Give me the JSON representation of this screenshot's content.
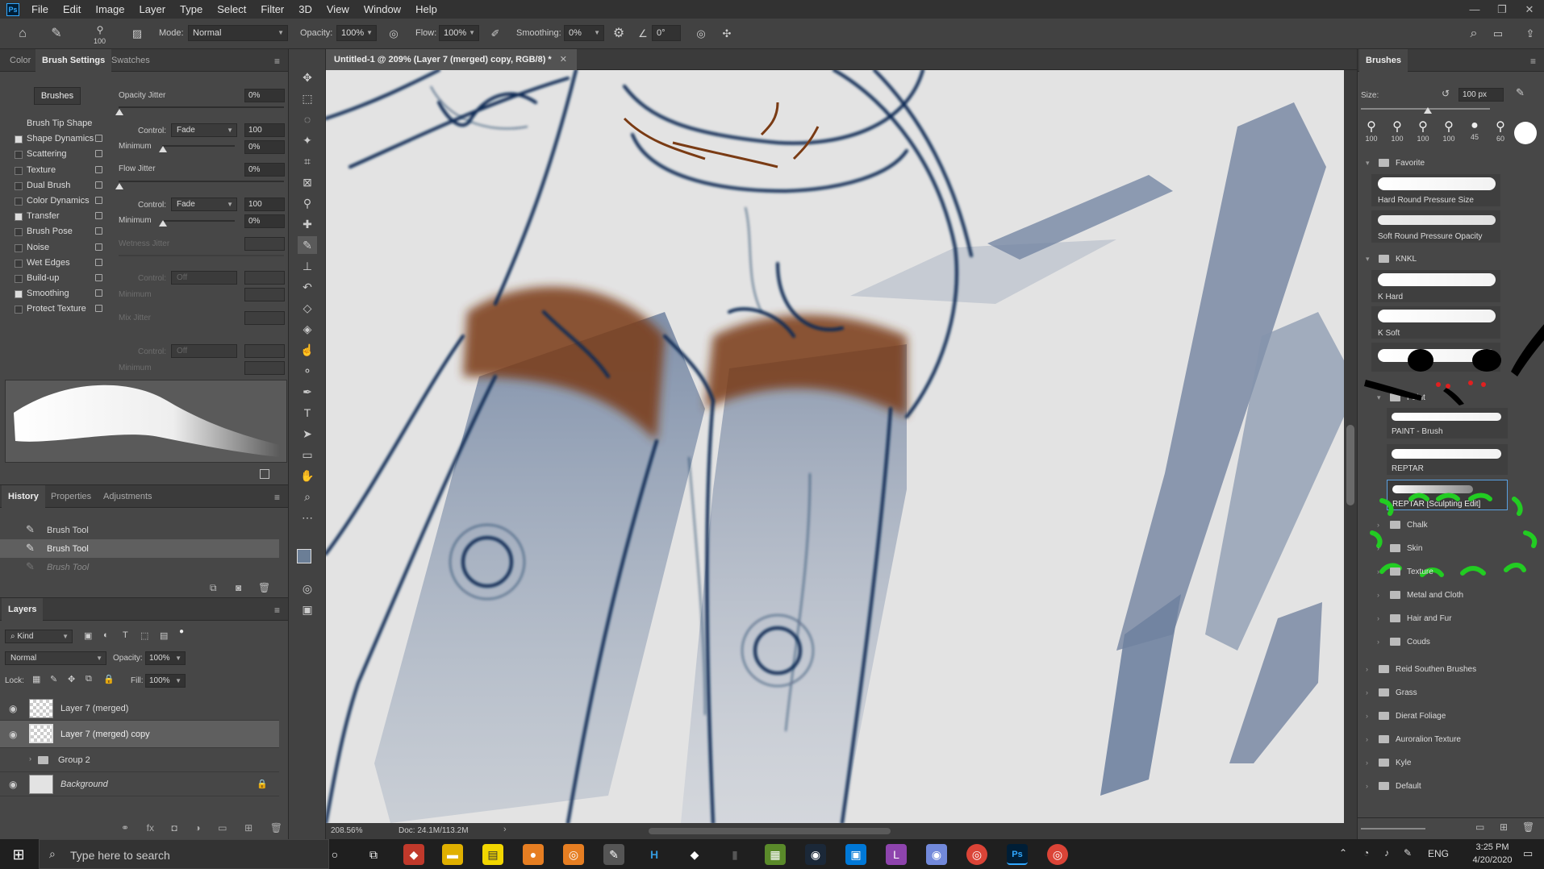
{
  "menu": {
    "items": [
      "File",
      "Edit",
      "Image",
      "Layer",
      "Type",
      "Select",
      "Filter",
      "3D",
      "View",
      "Window",
      "Help"
    ]
  },
  "options": {
    "brush_size": "100",
    "mode_label": "Mode:",
    "mode_value": "Normal",
    "opacity_label": "Opacity:",
    "opacity_value": "100%",
    "flow_label": "Flow:",
    "flow_value": "100%",
    "smoothing_label": "Smoothing:",
    "smoothing_value": "0%",
    "angle_value": "0°"
  },
  "left_panel": {
    "tabs": [
      "Color",
      "Brush Settings",
      "Swatches"
    ],
    "brushes_button": "Brushes",
    "items": [
      {
        "label": "Brush Tip Shape"
      },
      {
        "label": "Shape Dynamics",
        "checked": true
      },
      {
        "label": "Scattering",
        "checked": false
      },
      {
        "label": "Texture",
        "checked": false
      },
      {
        "label": "Dual Brush",
        "checked": false
      },
      {
        "label": "Color Dynamics",
        "checked": false
      },
      {
        "label": "Transfer",
        "checked": true
      },
      {
        "label": "Brush Pose",
        "checked": false
      },
      {
        "label": "Noise",
        "checked": false
      },
      {
        "label": "Wet Edges",
        "checked": false
      },
      {
        "label": "Build-up",
        "checked": false
      },
      {
        "label": "Smoothing",
        "checked": true
      },
      {
        "label": "Protect Texture",
        "checked": false
      }
    ],
    "transfer": {
      "opacity_jitter_label": "Opacity Jitter",
      "opacity_jitter": "0%",
      "control_label": "Control:",
      "control_value": "Fade",
      "control_num": "100",
      "minimum_label": "Minimum",
      "minimum": "0%",
      "flow_jitter_label": "Flow Jitter",
      "flow_jitter": "0%",
      "control2_value": "Fade",
      "control2_num": "100",
      "minimum2": "0%",
      "wetness_label": "Wetness Jitter",
      "control3_value": "Off",
      "minimum3_label": "Minimum",
      "mix_label": "Mix Jitter",
      "control4_value": "Off",
      "minimum4_label": "Minimum"
    }
  },
  "history": {
    "tabs": [
      "History",
      "Properties",
      "Adjustments"
    ],
    "items": [
      "Brush Tool",
      "Brush Tool",
      "Brush Tool"
    ]
  },
  "layers": {
    "tab": "Layers",
    "kind": "Kind",
    "blend": "Normal",
    "opacity_label": "Opacity:",
    "opacity": "100%",
    "lock_label": "Lock:",
    "fill_label": "Fill:",
    "fill": "100%",
    "items": [
      "Layer 7 (merged)",
      "Layer 7 (merged) copy",
      "Group 2",
      "Background"
    ]
  },
  "document": {
    "tab_title": "Untitled-1 @ 209% (Layer 7 (merged) copy, RGB/8) *",
    "zoom": "208.56%",
    "doc_size": "Doc: 24.1M/113.2M"
  },
  "brushes_panel": {
    "tab": "Brushes",
    "size_label": "Size:",
    "size_value": "100 px",
    "presets": [
      "100",
      "100",
      "100",
      "100",
      "45",
      "60"
    ],
    "groups": [
      {
        "name": "Favorite"
      },
      {
        "name": "KNKL"
      },
      {
        "name": "Paint"
      }
    ],
    "favorite": [
      "Hard Round Pressure Size",
      "Soft Round Pressure Opacity"
    ],
    "knkl": [
      "K Hard",
      "K Soft"
    ],
    "paint": [
      "PAINT - Brush",
      "REPTAR",
      "REPTAR [Sculpting Edit]"
    ],
    "subfolders": [
      "Chalk",
      "Skin",
      "Texture",
      "Metal and Cloth",
      "Hair and Fur",
      "Couds"
    ],
    "folders": [
      "Reid Southen Brushes",
      "Grass",
      "Dierat Foliage",
      "Auroralion Texture",
      "Kyle",
      "Default"
    ]
  },
  "taskbar": {
    "search_placeholder": "Type here to search",
    "lang": "ENG",
    "time": "3:25 PM",
    "date": "4/20/2020"
  },
  "colors": {
    "sketch": "#0e2c55",
    "wash": "#7889a0",
    "brown": "#7a3b14",
    "canvas": "#e3e3e3",
    "highlight_green": "#22cc22"
  }
}
